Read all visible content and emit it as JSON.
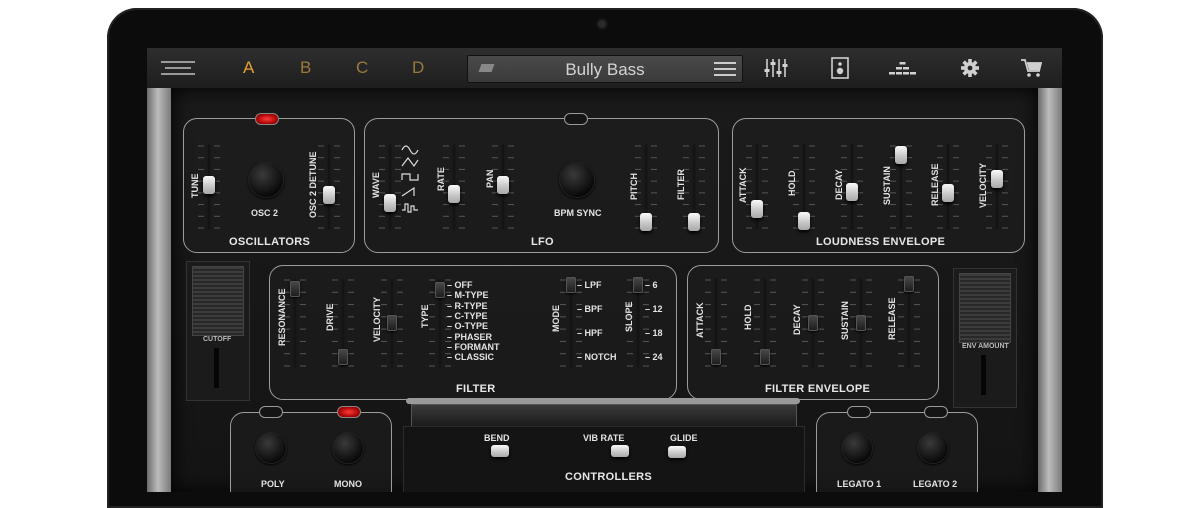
{
  "toolbar": {
    "tabs": [
      {
        "label": "A",
        "color": "#e6a032"
      },
      {
        "label": "B",
        "color": "#9a7a3c"
      },
      {
        "label": "C",
        "color": "#9a7a3c"
      },
      {
        "label": "D",
        "color": "#9a7a3c"
      }
    ],
    "preset_name": "Bully Bass"
  },
  "oscillators": {
    "title": "OSCILLATORS",
    "tune": "TUNE",
    "osc2": "OSC 2",
    "detune": "OSC 2 DETUNE"
  },
  "lfo": {
    "title": "LFO",
    "wave": "WAVE",
    "rate": "RATE",
    "pan": "PAN",
    "bpm_sync": "BPM SYNC",
    "pitch": "PITCH",
    "filter": "FILTER"
  },
  "loudness": {
    "title": "LOUDNESS ENVELOPE",
    "attack": "ATTACK",
    "hold": "HOLD",
    "decay": "DECAY",
    "sustain": "SUSTAIN",
    "release": "RELEASE",
    "velocity": "VELOCITY"
  },
  "filter": {
    "title": "FILTER",
    "resonance": "RESONANCE",
    "drive": "DRIVE",
    "velocity": "VELOCITY",
    "type": "TYPE",
    "types": [
      "OFF",
      "M-TYPE",
      "R-TYPE",
      "C-TYPE",
      "O-TYPE",
      "PHASER",
      "FORMANT",
      "CLASSIC"
    ],
    "mode": "MODE",
    "modes": [
      "LPF",
      "BPF",
      "HPF",
      "NOTCH"
    ],
    "slope": "SLOPE",
    "slopes": [
      "6",
      "12",
      "18",
      "24"
    ]
  },
  "filter_env": {
    "title": "FILTER ENVELOPE",
    "attack": "ATTACK",
    "hold": "HOLD",
    "decay": "DECAY",
    "sustain": "SUSTAIN",
    "release": "RELEASE"
  },
  "cutoff": "CUTOFF",
  "env_amount": "ENV AMOUNT",
  "voice": {
    "poly": "POLY",
    "mono": "MONO"
  },
  "controllers": {
    "title": "CONTROLLERS",
    "bend": "BEND",
    "vib_rate": "VIB RATE",
    "glide": "GLIDE"
  },
  "legato": {
    "l1": "LEGATO 1",
    "l2": "LEGATO 2"
  }
}
